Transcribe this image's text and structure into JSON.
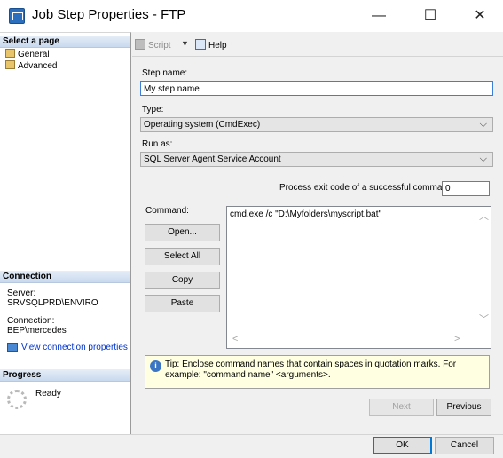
{
  "window": {
    "title": "Job Step Properties - FTP",
    "minimize_glyph": "—",
    "maximize_glyph": "☐",
    "close_glyph": "✕"
  },
  "sidebar": {
    "select_page_header": "Select a page",
    "pages": [
      {
        "label": "General",
        "icon": "page-wrench-icon"
      },
      {
        "label": "Advanced",
        "icon": "page-wrench-icon"
      }
    ],
    "connection_header": "Connection",
    "server_label": "Server:",
    "server_value": "SRVSQLPRD\\ENVIRO",
    "connection_label": "Connection:",
    "connection_value": "BEP\\mercedes",
    "view_connection_link": "View connection properties",
    "progress_header": "Progress",
    "progress_status": "Ready"
  },
  "toolbar": {
    "script_label": "Script",
    "dropdown_glyph": "▼",
    "help_label": "Help"
  },
  "form": {
    "step_name_label": "Step name:",
    "step_name_value": "My step name",
    "type_label": "Type:",
    "type_value": "Operating system (CmdExec)",
    "run_as_label": "Run as:",
    "run_as_value": "SQL Server Agent Service Account",
    "exit_code_label": "Process exit code of a successful command:",
    "exit_code_value": "0",
    "command_label": "Command:",
    "command_value": "cmd.exe /c \"D:\\Myfolders\\myscript.bat\"",
    "open_button": "Open...",
    "select_all_button": "Select All",
    "copy_button": "Copy",
    "paste_button": "Paste",
    "tip_text": "Tip: Enclose command names that contain spaces in quotation marks. For example: \"command name\" <arguments>."
  },
  "nav": {
    "next_button": "Next",
    "previous_button": "Previous"
  },
  "footer": {
    "ok_button": "OK",
    "cancel_button": "Cancel"
  },
  "colors": {
    "accent": "#0078d7",
    "tip_background": "#ffffe1",
    "link": "#0033cc"
  }
}
